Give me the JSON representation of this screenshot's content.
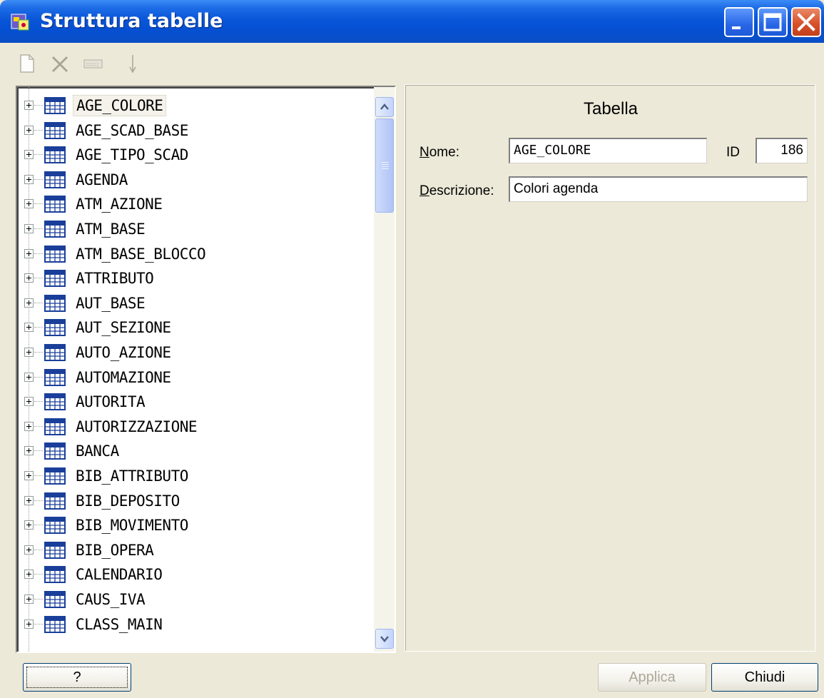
{
  "window": {
    "title": "Struttura tabelle",
    "controls": [
      "minimize-icon",
      "maximize-icon",
      "close-icon"
    ]
  },
  "toolbar": {
    "tools": [
      "new-document-icon",
      "delete-icon",
      "field-icon",
      "move-down-icon"
    ]
  },
  "tree": {
    "items": [
      {
        "label": "AGE_COLORE",
        "selected": true
      },
      {
        "label": "AGE_SCAD_BASE"
      },
      {
        "label": "AGE_TIPO_SCAD"
      },
      {
        "label": "AGENDA"
      },
      {
        "label": "ATM_AZIONE"
      },
      {
        "label": "ATM_BASE"
      },
      {
        "label": "ATM_BASE_BLOCCO"
      },
      {
        "label": "ATTRIBUTO"
      },
      {
        "label": "AUT_BASE"
      },
      {
        "label": "AUT_SEZIONE"
      },
      {
        "label": "AUTO_AZIONE"
      },
      {
        "label": "AUTOMAZIONE"
      },
      {
        "label": "AUTORITA"
      },
      {
        "label": "AUTORIZZAZIONE"
      },
      {
        "label": "BANCA"
      },
      {
        "label": "BIB_ATTRIBUTO"
      },
      {
        "label": "BIB_DEPOSITO"
      },
      {
        "label": "BIB_MOVIMENTO"
      },
      {
        "label": "BIB_OPERA"
      },
      {
        "label": "CALENDARIO"
      },
      {
        "label": "CAUS_IVA"
      },
      {
        "label": "CLASS_MAIN"
      }
    ]
  },
  "details": {
    "section_title": "Tabella",
    "nome_label_first": "N",
    "nome_label_rest": "ome:",
    "nome_value": "AGE_COLORE",
    "id_label": "ID",
    "id_value": "186",
    "descrizione_label_first": "D",
    "descrizione_label_rest": "escrizione:",
    "descrizione_value": "Colori agenda"
  },
  "buttons": {
    "help": "?",
    "apply": "Applica",
    "close": "Chiudi"
  },
  "colors": {
    "titlebar": "#0a56d8",
    "window_bg": "#ece9d8",
    "close_button": "#d9512a",
    "tree_icon": "#1a3f9a"
  }
}
